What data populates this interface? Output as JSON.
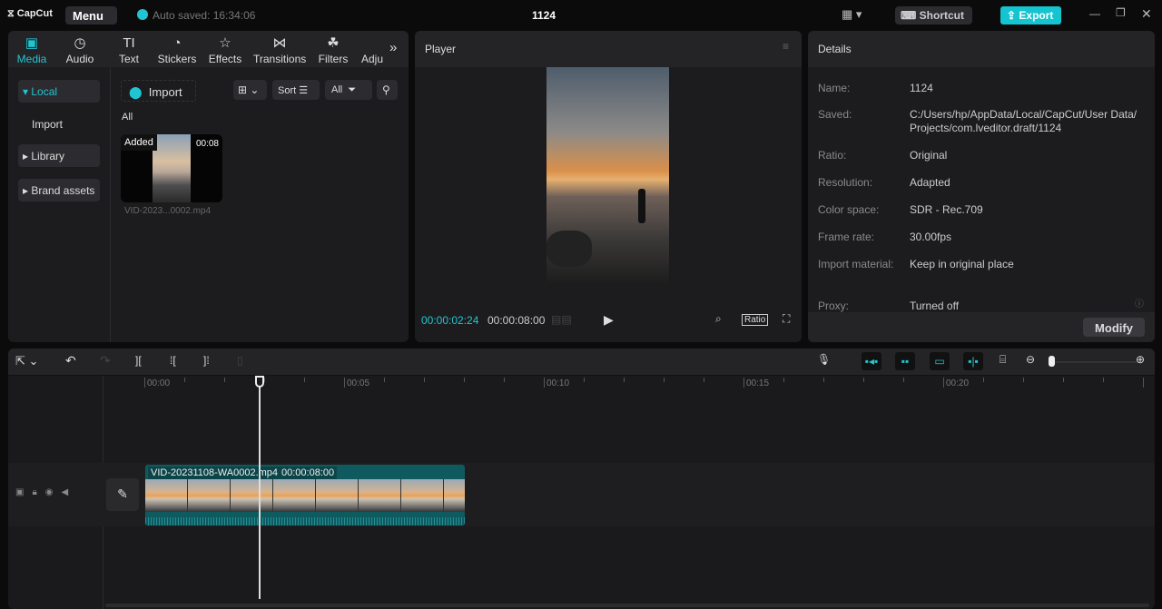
{
  "app": {
    "logo": "CapCut",
    "menu": "Menu",
    "autosave": "Auto saved: 16:34:06",
    "title": "1124",
    "shortcut": "Shortcut",
    "export": "Export"
  },
  "media_tabs": [
    {
      "label": "Media",
      "icon": "media-icon"
    },
    {
      "label": "Audio",
      "icon": "audio-icon"
    },
    {
      "label": "Text",
      "icon": "text-icon"
    },
    {
      "label": "Stickers",
      "icon": "stickers-icon"
    },
    {
      "label": "Effects",
      "icon": "effects-icon"
    },
    {
      "label": "Transitions",
      "icon": "transitions-icon"
    },
    {
      "label": "Filters",
      "icon": "filters-icon"
    },
    {
      "label": "Adju",
      "icon": "adjust-icon"
    }
  ],
  "sidebar": {
    "local": "Local",
    "import": "Import",
    "library": "Library",
    "brand": "Brand assets"
  },
  "media": {
    "import": "Import",
    "sort": "Sort",
    "all_filter": "All",
    "section": "All",
    "clip": {
      "badge": "Added",
      "duration": "00:08",
      "name": "VID-2023...0002.mp4"
    }
  },
  "player": {
    "title": "Player",
    "current": "00:00:02:24",
    "total": "00:00:08:00",
    "ratio": "Ratio"
  },
  "details": {
    "title": "Details",
    "rows": [
      {
        "label": "Name:",
        "value": "1124"
      },
      {
        "label": "Saved:",
        "value": "C:/Users/hp/AppData/Local/CapCut/User Data/ Projects/com.lveditor.draft/1124"
      },
      {
        "label": "Ratio:",
        "value": "Original"
      },
      {
        "label": "Resolution:",
        "value": "Adapted"
      },
      {
        "label": "Color space:",
        "value": "SDR - Rec.709"
      },
      {
        "label": "Frame rate:",
        "value": "30.00fps"
      },
      {
        "label": "Import material:",
        "value": "Keep in original place"
      },
      {
        "label": "Proxy:",
        "value": "Turned off"
      }
    ],
    "modify": "Modify"
  },
  "timeline": {
    "ticks": [
      "00:00",
      "00:05",
      "00:10",
      "00:15",
      "00:20"
    ],
    "clip_name": "VID-20231108-WA0002.mp4",
    "clip_duration": "00:00:08:00",
    "playhead_fraction": 0.36
  }
}
